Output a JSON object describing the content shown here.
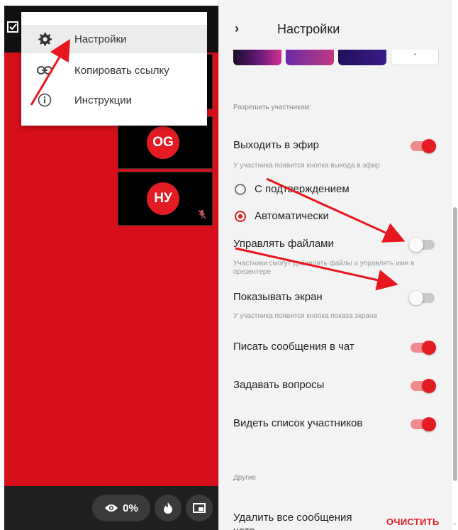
{
  "menu": {
    "items": [
      {
        "label": "Настройки",
        "icon": "gear-icon"
      },
      {
        "label": "Копировать ссылку",
        "icon": "link-icon"
      },
      {
        "label": "Инструкции",
        "icon": "info-icon"
      }
    ]
  },
  "stage": {
    "participants": [
      {
        "initials": "OG"
      },
      {
        "initials": "НУ",
        "muted": true
      }
    ],
    "views_percent": "0%"
  },
  "panel": {
    "title": "Настройки",
    "allow_section": "Разрешить участникам:",
    "broadcast": {
      "label": "Выходить в эфир",
      "on": true,
      "hint": "У участника появится кнопка выхода в эфир"
    },
    "confirm_option": "С подтверждением",
    "auto_option": "Автоматически",
    "files": {
      "label": "Управлять файлами",
      "on": false,
      "hint": "Участники смогут добавлять файлы и управлять ими в презентере"
    },
    "screen": {
      "label": "Показывать экран",
      "on": false,
      "hint": "У участника появится кнопка показа экрана"
    },
    "chat": {
      "label": "Писать сообщения в чат",
      "on": true
    },
    "questions": {
      "label": "Задавать вопросы",
      "on": true
    },
    "participants_list": {
      "label": "Видеть список участников",
      "on": true
    },
    "other_section": "Другие",
    "delete_messages": {
      "label": "Удалить все сообщения чата",
      "action": "ОЧИСТИТЬ"
    }
  },
  "colors": {
    "accent": "#e31b23",
    "stage": "#d70f1b"
  }
}
